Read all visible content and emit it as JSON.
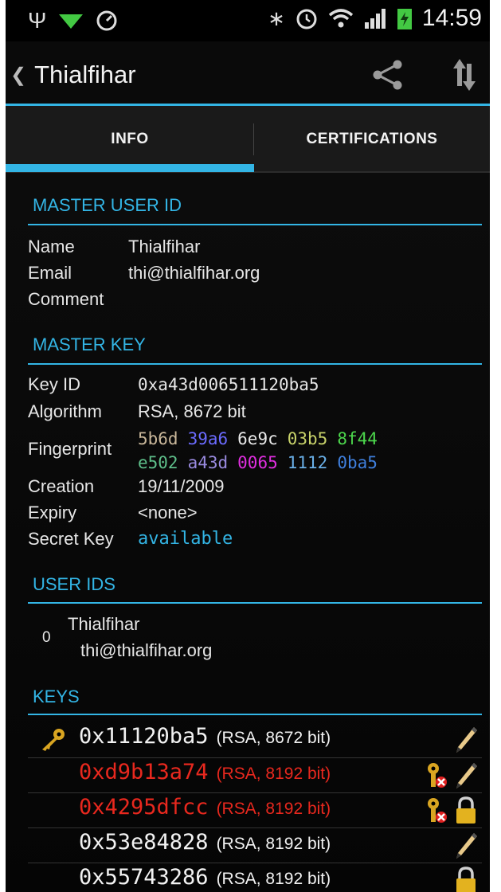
{
  "status_bar": {
    "time": "14:59"
  },
  "action_bar": {
    "title": "Thialfihar"
  },
  "tabs": [
    {
      "label": "INFO"
    },
    {
      "label": "CERTIFICATIONS"
    }
  ],
  "master_user_id": {
    "header": "MASTER USER ID",
    "name_label": "Name",
    "name_value": "Thialfihar",
    "email_label": "Email",
    "email_value": "thi@thialfihar.org",
    "comment_label": "Comment",
    "comment_value": ""
  },
  "master_key": {
    "header": "MASTER KEY",
    "key_id_label": "Key ID",
    "key_id_value": "0xa43d006511120ba5",
    "algorithm_label": "Algorithm",
    "algorithm_value": "RSA, 8672 bit",
    "fingerprint_label": "Fingerprint",
    "fingerprint": [
      "5b6d",
      "39a6",
      "6e9c",
      "03b5",
      "8f44",
      "e502",
      "a43d",
      "0065",
      "1112",
      "0ba5"
    ],
    "fingerprint_colors": [
      "#c9b79a",
      "#6b6bff",
      "#e8e8e8",
      "#c8d26a",
      "#4cd64c",
      "#5ebf8a",
      "#9a8be0",
      "#e02ee0",
      "#6ab0e8",
      "#3f7fdc"
    ],
    "creation_label": "Creation",
    "creation_value": "19/11/2009",
    "expiry_label": "Expiry",
    "expiry_value": "<none>",
    "secret_label": "Secret Key",
    "secret_value": "available"
  },
  "user_ids": {
    "header": "USER IDS",
    "items": [
      {
        "rank": "0",
        "name": "Thialfihar",
        "email": "thi@thialfihar.org"
      }
    ]
  },
  "keys": {
    "header": "KEYS",
    "items": [
      {
        "id": "0x11120ba5",
        "info": "(RSA, 8672 bit)",
        "color": "#f2f2f2",
        "master": true,
        "revoked": false,
        "can_sign": true,
        "can_encrypt": false
      },
      {
        "id": "0xd9b13a74",
        "info": "(RSA, 8192 bit)",
        "color": "#e8281e",
        "master": false,
        "revoked": true,
        "can_sign": true,
        "can_encrypt": false
      },
      {
        "id": "0x4295dfcc",
        "info": "(RSA, 8192 bit)",
        "color": "#e8281e",
        "master": false,
        "revoked": true,
        "can_sign": false,
        "can_encrypt": true
      },
      {
        "id": "0x53e84828",
        "info": "(RSA, 8192 bit)",
        "color": "#f2f2f2",
        "master": false,
        "revoked": false,
        "can_sign": true,
        "can_encrypt": false
      },
      {
        "id": "0x55743286",
        "info": "(RSA, 8192 bit)",
        "color": "#f2f2f2",
        "master": false,
        "revoked": false,
        "can_sign": false,
        "can_encrypt": true
      }
    ]
  },
  "colors": {
    "accent": "#33b5e5",
    "revoked": "#e8281e",
    "secret_available": "#33b5e5"
  }
}
